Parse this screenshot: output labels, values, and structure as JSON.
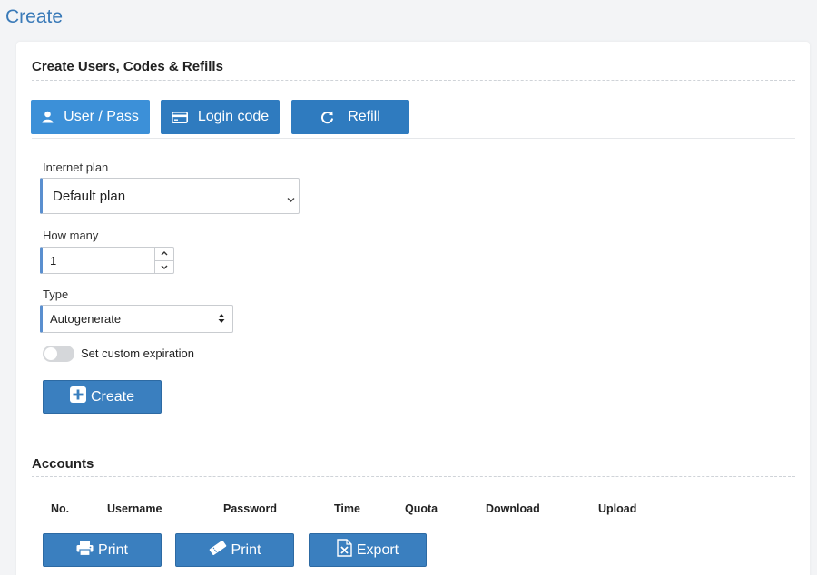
{
  "page": {
    "title": "Create"
  },
  "create_section": {
    "title": "Create Users, Codes & Refills",
    "tabs": [
      {
        "label": "User / Pass",
        "icon": "user-icon",
        "active": true
      },
      {
        "label": "Login code",
        "icon": "card-icon",
        "active": false
      },
      {
        "label": "Refill",
        "icon": "refresh-icon",
        "active": false
      }
    ]
  },
  "form": {
    "plan_label": "Internet plan",
    "plan_value": "Default plan",
    "howmany_label": "How many",
    "howmany_value": "1",
    "type_label": "Type",
    "type_value": "Autogenerate",
    "expiration_label": "Set custom expiration",
    "expiration_enabled": false,
    "create_button": "Create"
  },
  "accounts": {
    "title": "Accounts",
    "columns": [
      "No.",
      "Username",
      "Password",
      "Time",
      "Quota",
      "Download",
      "Upload"
    ],
    "rows": [],
    "buttons": [
      {
        "label": "Print",
        "icon": "printer-icon"
      },
      {
        "label": "Print",
        "icon": "ticket-icon"
      },
      {
        "label": "Export",
        "icon": "excel-icon"
      }
    ]
  },
  "colors": {
    "accent": "#3a7ab8",
    "button": "#2f7bbf",
    "button_active": "#3c90d8",
    "input_accent": "#5a8fcf"
  }
}
